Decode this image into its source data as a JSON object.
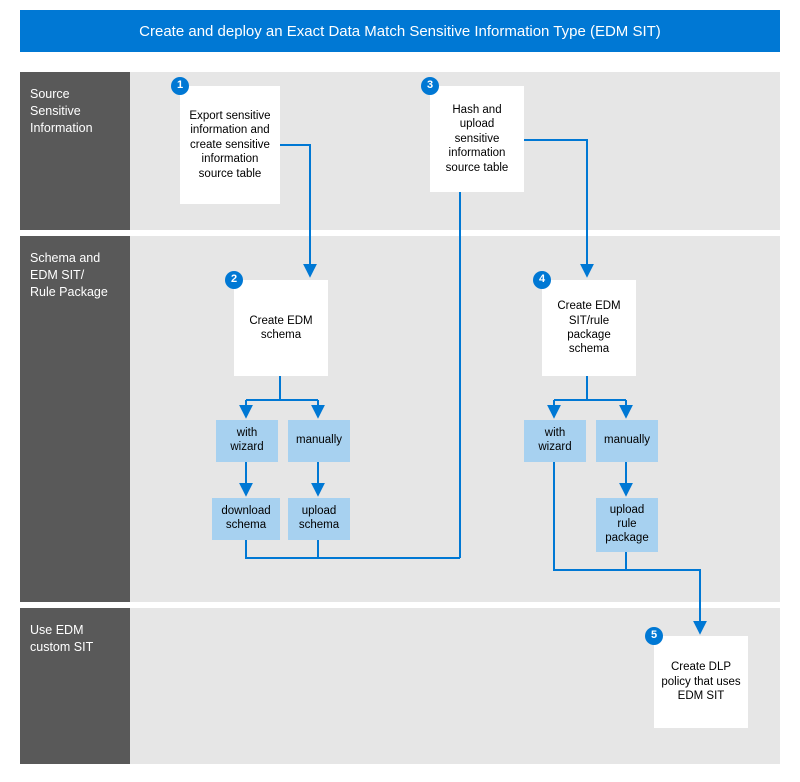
{
  "title": "Create and deploy an Exact Data Match Sensitive Information Type (EDM SIT)",
  "rows": {
    "r1": {
      "label": "Source Sensitive Information"
    },
    "r2": {
      "label": "Schema and EDM SIT/\nRule Package"
    },
    "r3": {
      "label": "Use EDM custom SIT"
    }
  },
  "steps": {
    "s1": {
      "num": "1",
      "text": "Export sensitive information and create sensitive information source table"
    },
    "s2": {
      "num": "2",
      "text": "Create EDM schema"
    },
    "s3": {
      "num": "3",
      "text": "Hash and upload sensitive information source table"
    },
    "s4": {
      "num": "4",
      "text": "Create EDM SIT/rule package schema"
    },
    "s5": {
      "num": "5",
      "text": "Create DLP policy that uses EDM SIT"
    }
  },
  "options": {
    "a_wizard": "with wizard",
    "a_manual": "manually",
    "a_download": "download schema",
    "a_upload": "upload schema",
    "b_wizard": "with wizard",
    "b_manual": "manually",
    "b_upload": "upload rule package"
  },
  "colors": {
    "primary": "#0078d4",
    "panel": "#e6e6e6",
    "sidebar": "#595959",
    "lightblue": "#a7d1f0"
  }
}
